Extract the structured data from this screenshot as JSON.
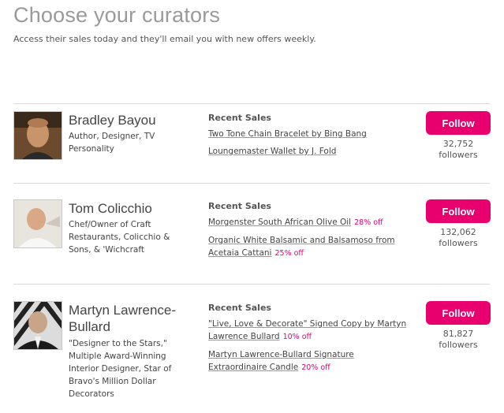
{
  "header": {
    "title": "Choose your curators",
    "subtitle": "Access their sales today and they'll email you with new offers weekly."
  },
  "curators": [
    {
      "name": "Bradley Bayou",
      "bio": "Author, Designer, TV Personality",
      "sales_heading": "Recent Sales",
      "sales": [
        {
          "title": "Two Tone Chain Bracelet by Bing Bang",
          "discount": ""
        },
        {
          "title": "Loungemaster Wallet by J. Fold",
          "discount": ""
        }
      ],
      "follow_label": "Follow",
      "followers_count": "32,752",
      "followers_label": "followers"
    },
    {
      "name": "Tom Colicchio",
      "bio": "Chef/Owner of Craft Restaurants, Colicchio & Sons, & 'Wichcraft",
      "sales_heading": "Recent Sales",
      "sales": [
        {
          "title": "Morgenster South African Olive Oil",
          "discount": "28% off"
        },
        {
          "title": "Organic White Balsamic and Balsamoso from Acetaia Cattani",
          "discount": "25% off"
        }
      ],
      "follow_label": "Follow",
      "followers_count": "132,062",
      "followers_label": "followers"
    },
    {
      "name": "Martyn Lawrence-Bullard",
      "bio": "\"Designer to the Stars,\" Multiple Award-Winning Interior Designer, Star of Bravo's Million Dollar Decorators",
      "sales_heading": "Recent Sales",
      "sales": [
        {
          "title": "\"Live, Love & Decorate\" Signed Copy by Martyn Lawrence Bullard",
          "discount": "10% off"
        },
        {
          "title": "Martyn Lawrence-Bullard Signature Extraordinaire Candle",
          "discount": "20% off"
        }
      ],
      "follow_label": "Follow",
      "followers_count": "81,827",
      "followers_label": "followers"
    }
  ],
  "colors": {
    "accent": "#e8006f",
    "discount": "#e2007a",
    "title": "#9a9a9a"
  }
}
